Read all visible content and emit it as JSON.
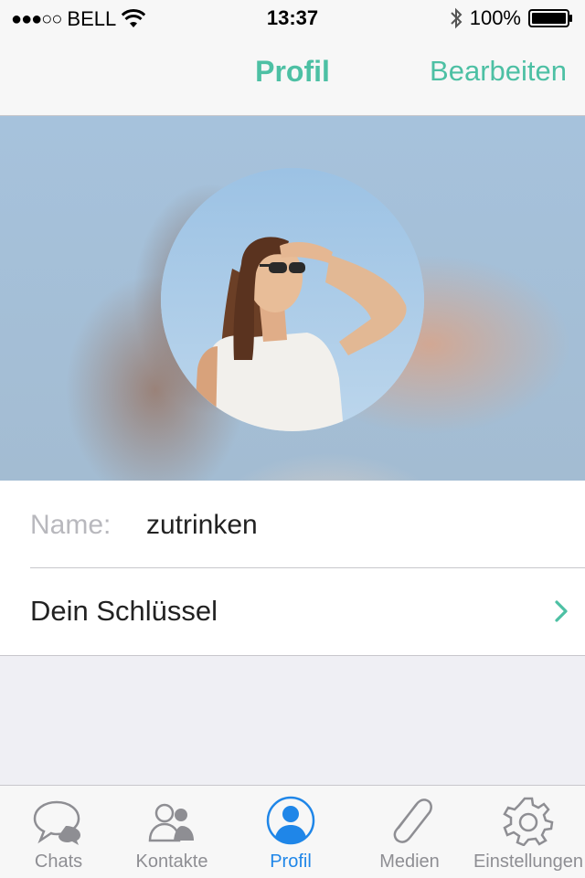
{
  "status_bar": {
    "signal_dots": "●●●○○",
    "carrier": "BELL",
    "time": "13:37",
    "battery": "100%",
    "icons": [
      "wifi-icon",
      "bluetooth-icon",
      "battery-icon"
    ]
  },
  "nav": {
    "title": "Profil",
    "edit_label": "Bearbeiten"
  },
  "profile": {
    "name_label": "Name:",
    "name_value": "zutrinken",
    "key_label": "Dein Schlüssel"
  },
  "colors": {
    "accent": "#4dc0a4",
    "tab_active": "#1f86e8",
    "tab_inactive": "#8e8e93",
    "background": "#efeff4"
  },
  "tabs": [
    {
      "label": "Chats",
      "icon": "chat-bubbles-icon",
      "active": false
    },
    {
      "label": "Kontakte",
      "icon": "contacts-icon",
      "active": false
    },
    {
      "label": "Profil",
      "icon": "profile-icon",
      "active": true
    },
    {
      "label": "Medien",
      "icon": "paperclip-icon",
      "active": false
    },
    {
      "label": "Einstellungen",
      "icon": "gear-icon",
      "active": false
    }
  ]
}
